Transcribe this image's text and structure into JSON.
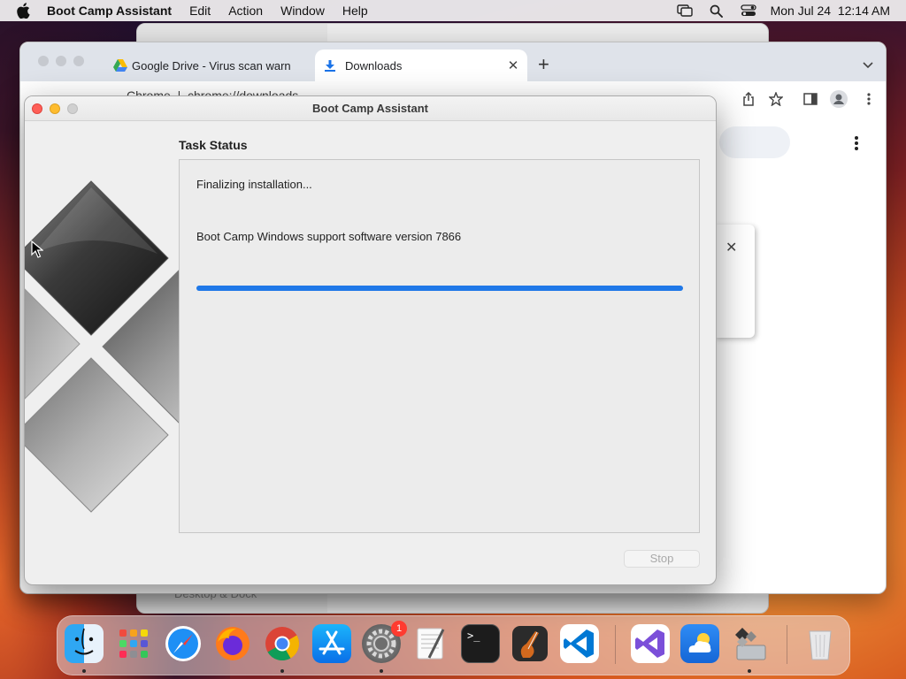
{
  "menubar": {
    "app_name": "Boot Camp Assistant",
    "items": [
      "Edit",
      "Action",
      "Window",
      "Help"
    ],
    "clock": "Mon Jul 24  12:14 AM",
    "status_icons": [
      "screen-mirroring-icon",
      "spotlight-search-icon",
      "control-center-icon"
    ]
  },
  "background_window": {
    "bottom_text": "Desktop & Dock"
  },
  "chrome": {
    "tabs": [
      {
        "title": "Google Drive - Virus scan warn",
        "icon": "google-drive-icon"
      },
      {
        "title": "Downloads",
        "icon": "download-icon"
      }
    ],
    "new_tab_label": "+",
    "url_text": "Chrome  |  chrome://downloads",
    "dialog_close": "✕"
  },
  "bootcamp": {
    "window_title": "Boot Camp Assistant",
    "heading": "Task Status",
    "status_line1": "Finalizing installation...",
    "status_line2": "Boot Camp Windows support software version 7866",
    "progress": 1.0,
    "stop_label": "Stop"
  },
  "dock": {
    "apps": [
      {
        "name": "Finder",
        "icon": "finder-icon",
        "running": true
      },
      {
        "name": "Launchpad",
        "icon": "launchpad-icon",
        "running": false
      },
      {
        "name": "Safari",
        "icon": "safari-icon",
        "running": false
      },
      {
        "name": "Firefox",
        "icon": "firefox-icon",
        "running": false
      },
      {
        "name": "Google Chrome",
        "icon": "chrome-icon",
        "running": true
      },
      {
        "name": "App Store",
        "icon": "app-store-icon",
        "running": false
      },
      {
        "name": "System Settings",
        "icon": "system-settings-icon",
        "running": true,
        "badge": "1"
      },
      {
        "name": "TextEdit",
        "icon": "textedit-icon",
        "running": false
      },
      {
        "name": "Terminal",
        "icon": "terminal-icon",
        "running": false
      },
      {
        "name": "GarageBand",
        "icon": "garageband-icon",
        "running": false
      },
      {
        "name": "Visual Studio Code",
        "icon": "vscode-icon",
        "running": false
      },
      {
        "name": "Visual Studio",
        "icon": "visual-studio-icon",
        "running": false
      },
      {
        "name": "Weather",
        "icon": "weather-icon",
        "running": false
      },
      {
        "name": "Boot Camp Assistant",
        "icon": "bootcamp-icon",
        "running": true
      },
      {
        "name": "Trash",
        "icon": "trash-icon",
        "running": false
      }
    ],
    "terminal_prompt": ">_"
  },
  "colors": {
    "progress": "#1f78e8",
    "close": "#fe5f57",
    "minimize": "#febc2e",
    "zoom_inactive": "#d0d0d0",
    "badge": "#ff3b30"
  }
}
